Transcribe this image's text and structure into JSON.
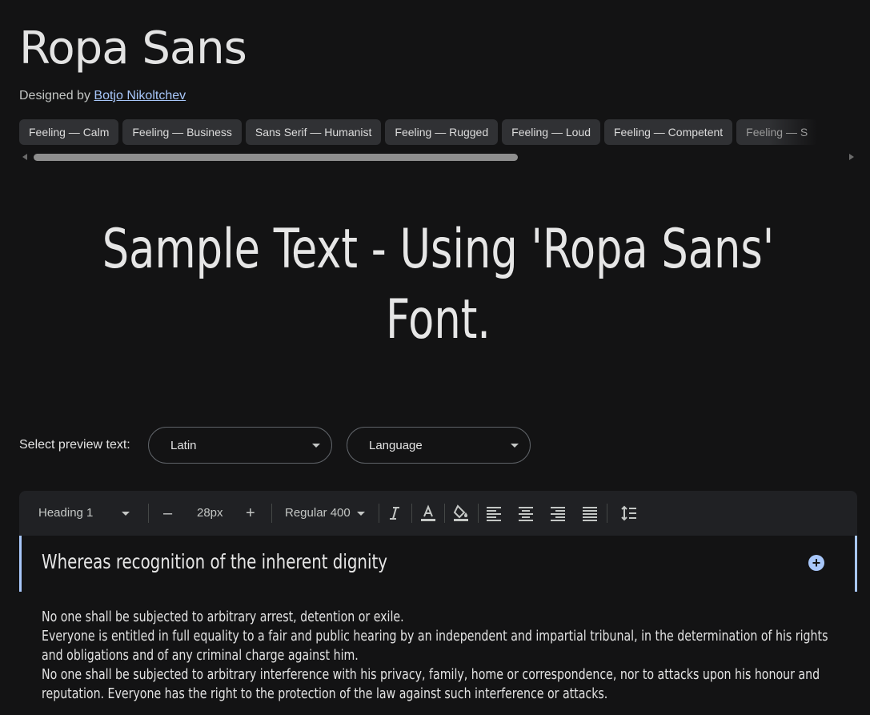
{
  "font": {
    "name": "Ropa Sans",
    "designed_by_label": "Designed by",
    "designer": "Botjo Nikoltchev"
  },
  "tags": [
    "Feeling — Calm",
    "Feeling — Business",
    "Sans Serif — Humanist",
    "Feeling — Rugged",
    "Feeling — Loud",
    "Feeling — Competent",
    "Feeling — S"
  ],
  "sample_text": "Sample Text - Using 'Ropa Sans' Font.",
  "preview": {
    "label": "Select preview text:",
    "script_select": "Latin",
    "language_select": "Language"
  },
  "toolbar": {
    "text_style": "Heading 1",
    "decrease": "–",
    "size": "28px",
    "increase": "+",
    "weight": "Regular 400"
  },
  "preview_heading": "Whereas recognition of the inherent dignity",
  "body_paragraphs": [
    "No one shall be subjected to arbitrary arrest, detention or exile.",
    "Everyone is entitled in full equality to a fair and public hearing by an independent and impartial tribunal, in the determination of his rights and obligations and of any criminal charge against him.",
    "No one shall be subjected to arbitrary interference with his privacy, family, home or correspondence, nor to attacks upon his honour and reputation. Everyone has the right to the protection of the law against such interference or attacks."
  ],
  "icons": {
    "italic": "italic-icon",
    "text_color": "text-color-icon",
    "highlight": "fill-color-icon",
    "align_left": "align-left-icon",
    "align_center": "align-center-icon",
    "align_right": "align-right-icon",
    "align_justify": "align-justify-icon",
    "line_height": "line-height-icon",
    "add": "add-circle-icon"
  },
  "colors": {
    "background": "#131314",
    "accent": "#a8c7fa",
    "chip": "#303134"
  }
}
